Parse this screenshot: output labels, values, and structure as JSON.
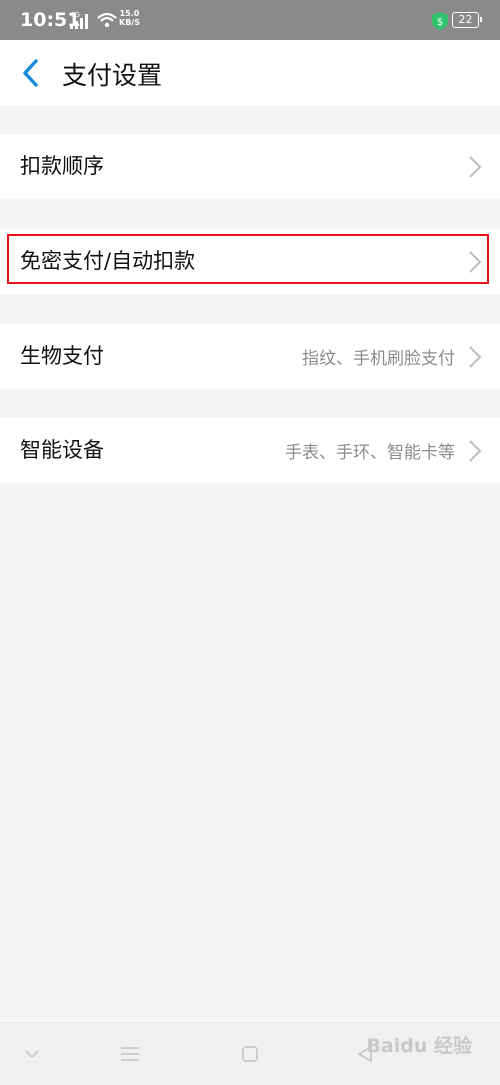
{
  "status_bar": {
    "time": "10:51",
    "network": "4G",
    "speed_value": "15.0",
    "speed_unit": "KB/S",
    "battery": "22"
  },
  "header": {
    "title": "支付设置"
  },
  "settings": {
    "items": [
      {
        "label": "扣款顺序",
        "value": ""
      },
      {
        "label": "免密支付/自动扣款",
        "value": ""
      },
      {
        "label": "生物支付",
        "value": "指纹、手机刷脸支付"
      },
      {
        "label": "智能设备",
        "value": "手表、手环、智能卡等"
      }
    ]
  },
  "watermark": {
    "text": "Baidu 经验"
  },
  "colors": {
    "accent": "#1a8cdc",
    "highlight": "#e8121b",
    "status_bar": "#8a8a8a"
  }
}
